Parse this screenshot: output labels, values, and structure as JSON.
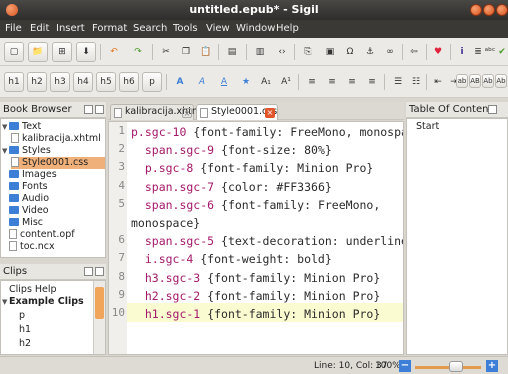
{
  "window": {
    "title": "untitled.epub* - Sigil"
  },
  "menu": [
    "File",
    "Edit",
    "Insert",
    "Format",
    "Search",
    "Tools",
    "View",
    "Window",
    "Help"
  ],
  "toolbar2": {
    "headings": [
      "h1",
      "h2",
      "h3",
      "h4",
      "h5",
      "h6",
      "p"
    ],
    "styles": [
      "ab",
      "AB",
      "Ab",
      "Ab"
    ]
  },
  "book_browser": {
    "title": "Book Browser",
    "items": [
      {
        "label": "Text",
        "type": "folder",
        "expanded": true
      },
      {
        "label": "kalibracija.xhtml",
        "type": "file"
      },
      {
        "label": "Styles",
        "type": "folder",
        "expanded": true
      },
      {
        "label": "Style0001.css",
        "type": "file",
        "selected": true
      },
      {
        "label": "Images",
        "type": "folder"
      },
      {
        "label": "Fonts",
        "type": "folder"
      },
      {
        "label": "Audio",
        "type": "folder"
      },
      {
        "label": "Video",
        "type": "folder"
      },
      {
        "label": "Misc",
        "type": "folder"
      },
      {
        "label": "content.opf",
        "type": "file"
      },
      {
        "label": "toc.ncx",
        "type": "file"
      }
    ]
  },
  "clips": {
    "title": "Clips",
    "items": [
      {
        "label": "Clips Help"
      },
      {
        "label": "Example Clips",
        "bold": true
      },
      {
        "label": "p"
      },
      {
        "label": "h1"
      },
      {
        "label": "h2"
      }
    ]
  },
  "tabs": [
    {
      "label": "kalibracija.xhtml",
      "active": false
    },
    {
      "label": "Style0001.css",
      "active": true
    }
  ],
  "editor": {
    "lines": [
      {
        "num": "1",
        "sel": "p.sgc-10",
        "body": " {font-family: FreeMono, monospace}"
      },
      {
        "num": "2",
        "sel": "  span.sgc-9",
        "body": " {font-size: 80%}"
      },
      {
        "num": "3",
        "sel": "  p.sgc-8",
        "body": " {font-family: Minion Pro}"
      },
      {
        "num": "4",
        "sel": "  span.sgc-7",
        "body": " {color: #FF3366}"
      },
      {
        "num": "5",
        "sel": "  span.sgc-6",
        "body": " {font-family: FreeMono,"
      },
      {
        "num": "",
        "sel": "",
        "body": "monospace}"
      },
      {
        "num": "6",
        "sel": "  span.sgc-5",
        "body": " {text-decoration: underline}"
      },
      {
        "num": "7",
        "sel": "  i.sgc-4",
        "body": " {font-weight: bold}"
      },
      {
        "num": "8",
        "sel": "  h3.sgc-3",
        "body": " {font-family: Minion Pro}"
      },
      {
        "num": "9",
        "sel": "  h2.sgc-2",
        "body": " {font-family: Minion Pro}"
      },
      {
        "num": "10",
        "sel": "  h1.sgc-1",
        "body": " {font-family: Minion Pro}"
      }
    ],
    "current_line": "10"
  },
  "toc": {
    "title": "Table Of Contents",
    "items": [
      "Start"
    ]
  },
  "status": {
    "position": "Line: 10, Col: 37",
    "zoom": "100%"
  },
  "colors": {
    "accent": "#f0a55b",
    "selector": "#a4186a",
    "selected_row": "#f0b07a"
  }
}
